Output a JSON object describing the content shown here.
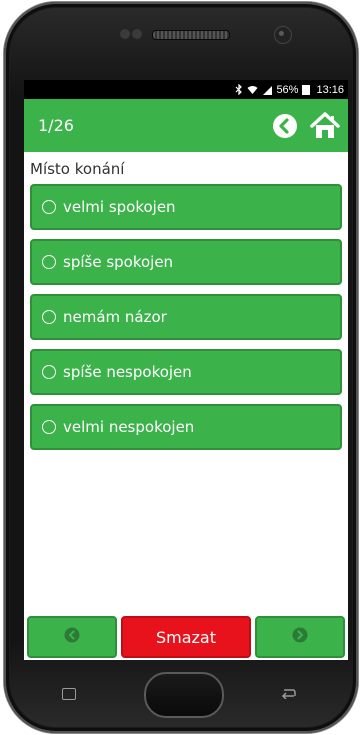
{
  "status_bar": {
    "bluetooth_icon": "bluetooth-icon",
    "wifi_icon": "wifi-icon",
    "signal_icon": "signal-icon",
    "battery_percent": "56%",
    "time": "13:16"
  },
  "app_bar": {
    "counter": "1/26",
    "back_icon": "chevron-left-circle-icon",
    "home_icon": "home-icon"
  },
  "question": {
    "title": "Místo konání"
  },
  "options": [
    {
      "label": "velmi spokojen",
      "selected": false
    },
    {
      "label": "spíše spokojen",
      "selected": false
    },
    {
      "label": "nemám názor",
      "selected": false
    },
    {
      "label": "spíše nespokojen",
      "selected": false
    },
    {
      "label": "velmi nespokojen",
      "selected": false
    }
  ],
  "bottom_bar": {
    "prev_icon": "chevron-left-circle-icon",
    "delete_label": "Smazat",
    "next_icon": "chevron-right-circle-icon"
  },
  "colors": {
    "primary_green": "#3bb34a",
    "border_green": "#2f8f3b",
    "delete_red": "#e8121c",
    "disabled_icon": "#2c7a37"
  }
}
